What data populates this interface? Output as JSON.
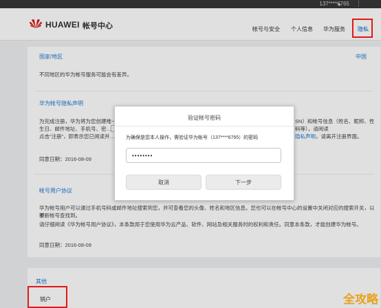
{
  "topbar": {
    "account": "137****6765"
  },
  "header": {
    "brand": "HUAWEI",
    "center_title": "帐号中心",
    "nav": [
      "帐号与安全",
      "个人信息",
      "华为服务",
      "隐私"
    ]
  },
  "sections": [
    {
      "title": "国家/地区",
      "action": "中国",
      "text": "不同地区的华为帐号服务可能会有差异。"
    },
    {
      "title": "华为帐号隐私声明",
      "lines": [
        "为完成注册，华为将为您创建唯一…",
        "生日、邮件地址、手机号、密…",
        "点击“注册”，即表示您已阅读并…"
      ],
      "right_lines": [
        "SN）和帐号信息（姓名、昵称、性",
        "码等），请阅读",
        "隐私声明",
        "，请离开注册界面。"
      ],
      "date": "同意日期：2016-08-09"
    },
    {
      "title": "帐号用户协议",
      "lines": [
        "华为帐号用户可以通过手机号码或邮件地址搜索到您，并可查看您的头像、姓名和地区信息。您也可以在帐号中心的设置中关闭对应的搜索开关，以不",
        "被新帐号查找到。",
        "请仔细阅读《华为帐号用户协议》，本条款用于您使用华为云产品、软件、网站及相关服务时的权利和责任。同意本条款，才能创建华为帐号。"
      ],
      "date": "同意日期：2016-08-09"
    }
  ],
  "bottom": {
    "title": "其他",
    "item": "销户"
  },
  "dialog": {
    "title": "验证帐号密码",
    "prompt": "为确保是您本人操作，需验证华为帐号（137****6765）的密码",
    "password": "••••••••",
    "cancel": "取消",
    "next": "下一步"
  },
  "watermark": "全攻略",
  "colors": {
    "link": "#1e7ad4",
    "active_nav": "#0a64c8",
    "highlight": "#e01818"
  }
}
